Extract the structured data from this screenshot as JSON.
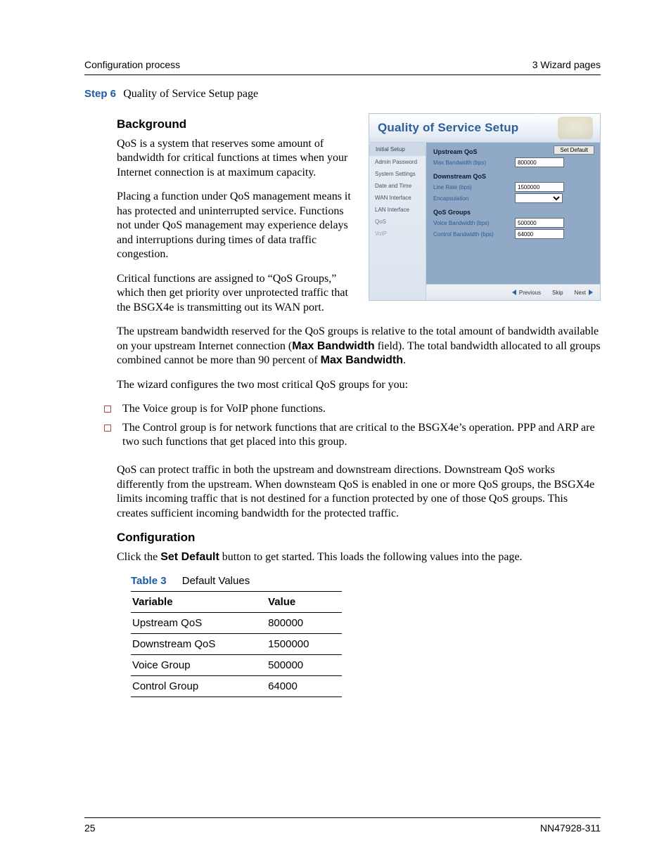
{
  "header": {
    "left": "Configuration process",
    "right": "3 Wizard pages"
  },
  "step": {
    "label": "Step 6",
    "title": "Quality of Service Setup page"
  },
  "sections": {
    "background": {
      "title": "Background",
      "p1": "QoS is a system that reserves some amount of bandwidth for critical functions at times when your Internet connection is at maximum capacity.",
      "p2": "Placing a function under QoS management means it has protected and uninterrupted service. Functions not under QoS management may experience delays and interruptions during times of data traffic congestion.",
      "p3": "Critical functions are assigned to “QoS Groups,” which then get priority over unprotected traffic that the BSGX4e is transmitting out its WAN port.",
      "p4a": "The upstream bandwidth reserved for the QoS groups is relative to the total amount of bandwidth available on your upstream Internet connection (",
      "p4_bold1": "Max Bandwidth",
      "p4b": " field). The total bandwidth allocated to all groups combined cannot be more than 90 percent of ",
      "p4_bold2": "Max Bandwidth",
      "p4c": ".",
      "p5": "The wizard configures the two most critical QoS groups for you:",
      "b1": "The Voice group is for VoIP phone functions.",
      "b2": "The Control group is for network functions that are critical to the BSGX4e’s operation. PPP and ARP are two such functions that get placed into this group.",
      "p6": "QoS can protect traffic in both the upstream and downstream directions. Downstream QoS works differently from the upstream. When downsteam QoS is enabled in one or more QoS groups, the BSGX4e limits incoming traffic that is not destined for a function protected by one of those QoS groups. This creates sufficient incoming bandwidth for the protected traffic."
    },
    "configuration": {
      "title": "Configuration",
      "p1a": "Click the ",
      "p1_bold": "Set Default",
      "p1b": " button to get started. This loads the following values into the page."
    }
  },
  "table": {
    "caption_label": "Table 3",
    "caption_title": "Default Values",
    "head": {
      "c1": "Variable",
      "c2": "Value"
    },
    "rows": [
      {
        "c1": "Upstream QoS",
        "c2": "800000"
      },
      {
        "c1": "Downstream QoS",
        "c2": "1500000"
      },
      {
        "c1": "Voice Group",
        "c2": "500000"
      },
      {
        "c1": "Control Group",
        "c2": "64000"
      }
    ]
  },
  "panel": {
    "title": "Quality of Service Setup",
    "tab": "Initial Setup",
    "nav": [
      "Admin Password",
      "System Settings",
      "Date and Time",
      "WAN Interface",
      "LAN Interface",
      "QoS",
      "VoIP"
    ],
    "nav_active_index": 5,
    "btn_set_default": "Set Default",
    "upstream": {
      "head": "Upstream QoS",
      "l1": "Max Bandwidth (bps)",
      "v1": "800000"
    },
    "downstream": {
      "head": "Downstream QoS",
      "l1": "Line Rate (bps)",
      "v1": "1500000",
      "l2": "Encapsulation",
      "v2": ""
    },
    "groups": {
      "head": "QoS Groups",
      "l1": "Voice Bandwidth (bps)",
      "v1": "500000",
      "l2": "Control Bandwidth (bps)",
      "v2": "64000"
    },
    "foot": {
      "prev": "Previous",
      "skip": "Skip",
      "next": "Next"
    }
  },
  "footer": {
    "left": "25",
    "right": "NN47928-311"
  }
}
